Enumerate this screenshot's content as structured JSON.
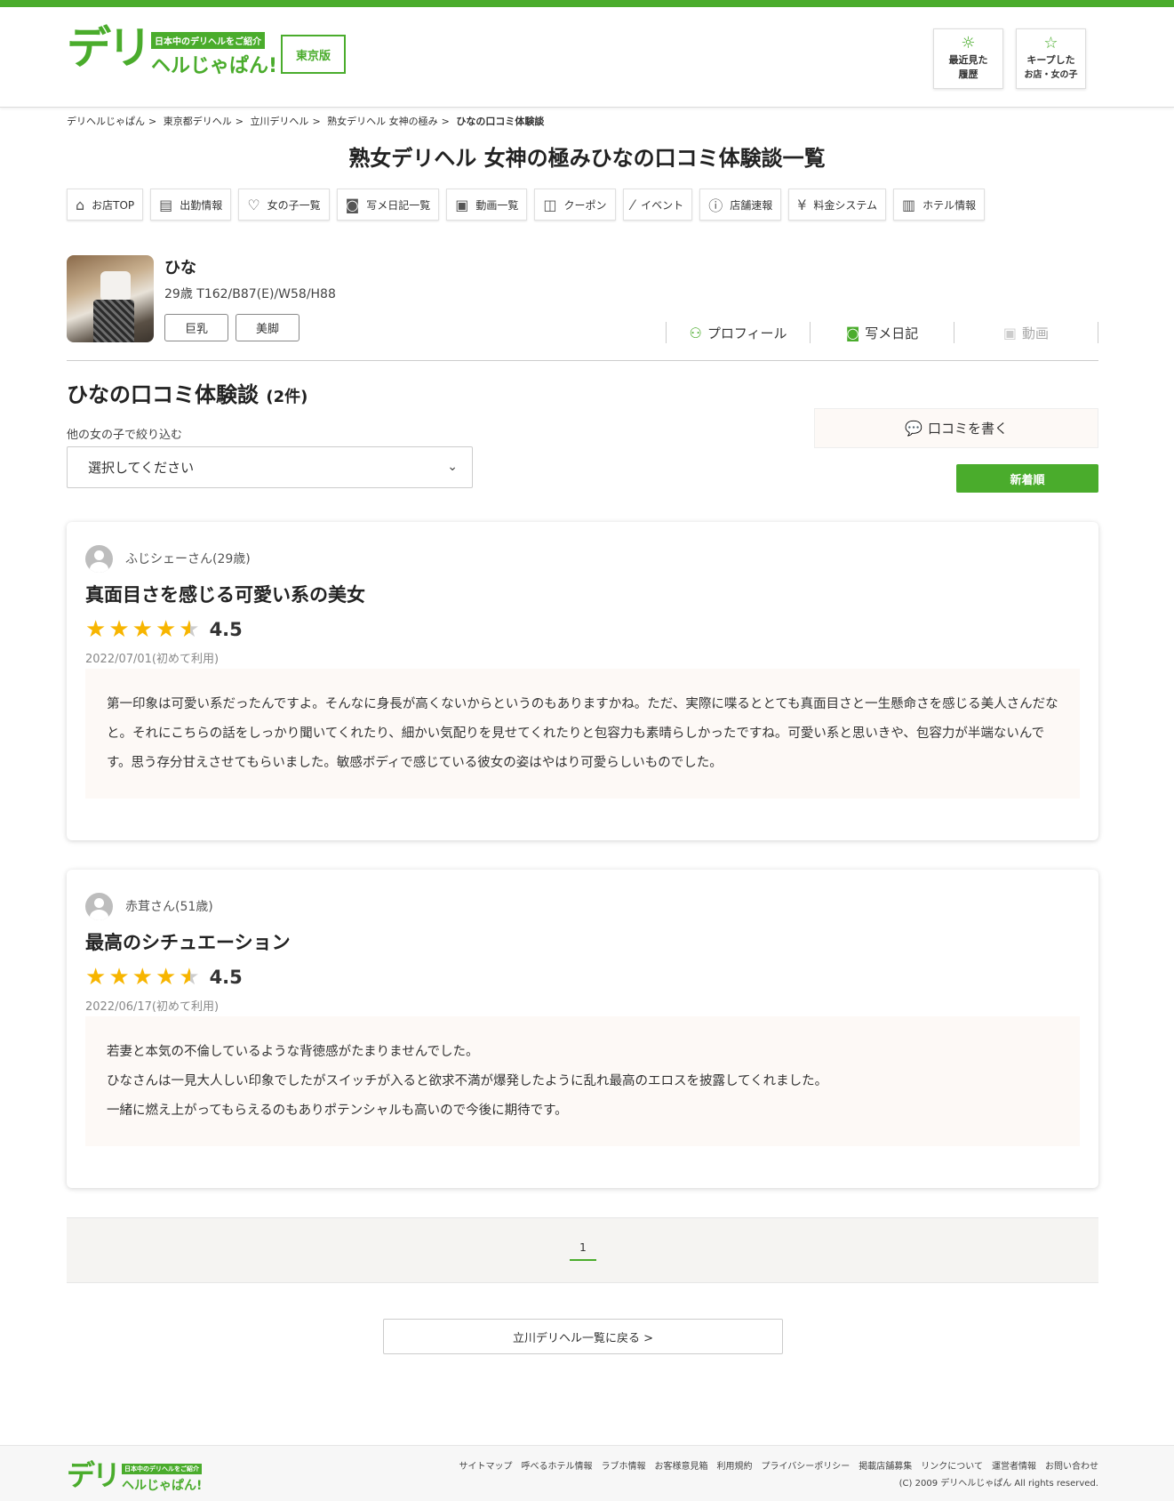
{
  "header": {
    "logo_big": "デリ",
    "logo_tagline": "日本中のデリヘルをご紹介",
    "logo_name": "ヘルじゃぱん!",
    "region": "東京版",
    "history_l1": "最近見た",
    "history_l2": "履歴",
    "keep_l1": "キープした",
    "keep_l2": "お店・女の子",
    "accent": "#4aac2c"
  },
  "breadcrumb": [
    "デリヘルじゃぱん",
    "東京都デリヘル",
    "立川デリヘル",
    "熟女デリヘル 女神の極み",
    "ひなの口コミ体験談"
  ],
  "page_title": "熟女デリヘル 女神の極みひなの口コミ体験談一覧",
  "shop_nav": [
    {
      "icon": "home-icon",
      "label": "お店TOP"
    },
    {
      "icon": "clipboard-icon",
      "label": "出勤情報"
    },
    {
      "icon": "heart-icon",
      "label": "女の子一覧"
    },
    {
      "icon": "camera-icon",
      "label": "写メ日記一覧"
    },
    {
      "icon": "video-icon",
      "label": "動画一覧"
    },
    {
      "icon": "map-icon",
      "label": "クーポン"
    },
    {
      "icon": "magic-wand-icon",
      "label": "イベント"
    },
    {
      "icon": "alert-icon",
      "label": "店舗速報"
    },
    {
      "icon": "yen-icon",
      "label": "料金システム"
    },
    {
      "icon": "building-icon",
      "label": "ホテル情報"
    }
  ],
  "girl": {
    "name": "ひな",
    "spec": "29歳 T162/B87(E)/W58/H88",
    "tags": [
      "巨乳",
      "美脚"
    ],
    "tabs": {
      "profile": "プロフィール",
      "diary": "写メ日記",
      "video": "動画"
    }
  },
  "section": {
    "title": "ひなの口コミ体験談",
    "count": "(2件)",
    "filter_label": "他の女の子で絞り込む",
    "filter_value": "選択してください",
    "write_button": "口コミを書く",
    "sort_button": "新着順"
  },
  "reviews": [
    {
      "author": "ふじシェーさん(29歳)",
      "title": "真面目さを感じる可愛い系の美女",
      "rating": 4.5,
      "rating_text": "4.5",
      "date": "2022/07/01(初めて利用)",
      "body": "第一印象は可愛い系だったんですよ。そんなに身長が高くないからというのもありますかね。ただ、実際に喋るととても真面目さと一生懸命さを感じる美人さんだなと。それにこちらの話をしっかり聞いてくれたり、細かい気配りを見せてくれたりと包容力も素晴らしかったですね。可愛い系と思いきや、包容力が半端ないんです。思う存分甘えさせてもらいました。敏感ボディで感じている彼女の姿はやはり可愛らしいものでした。"
    },
    {
      "author": "赤茸さん(51歳)",
      "title": "最高のシチュエーション",
      "rating": 4.5,
      "rating_text": "4.5",
      "date": "2022/06/17(初めて利用)",
      "body_lines": [
        "若妻と本気の不倫しているような背徳感がたまりませんでした。",
        "ひなさんは一見大人しい印象でしたがスイッチが入ると欲求不満が爆発したように乱れ最高のエロスを披露してくれました。",
        "一緒に燃え上がってもらえるのもありポテンシャルも高いので今後に期待です。"
      ]
    }
  ],
  "pager": {
    "current": "1"
  },
  "back_button": "立川デリヘル一覧に戻る >",
  "footer": {
    "links": [
      "サイトマップ",
      "呼べるホテル情報",
      "ラブホ情報",
      "お客様意見箱",
      "利用規約",
      "プライバシーポリシー",
      "掲載店舗募集",
      "リンクについて",
      "運営者情報",
      "お問い合わせ"
    ],
    "copyright": "(C) 2009 デリヘルじゃぱん All rights reserved."
  }
}
